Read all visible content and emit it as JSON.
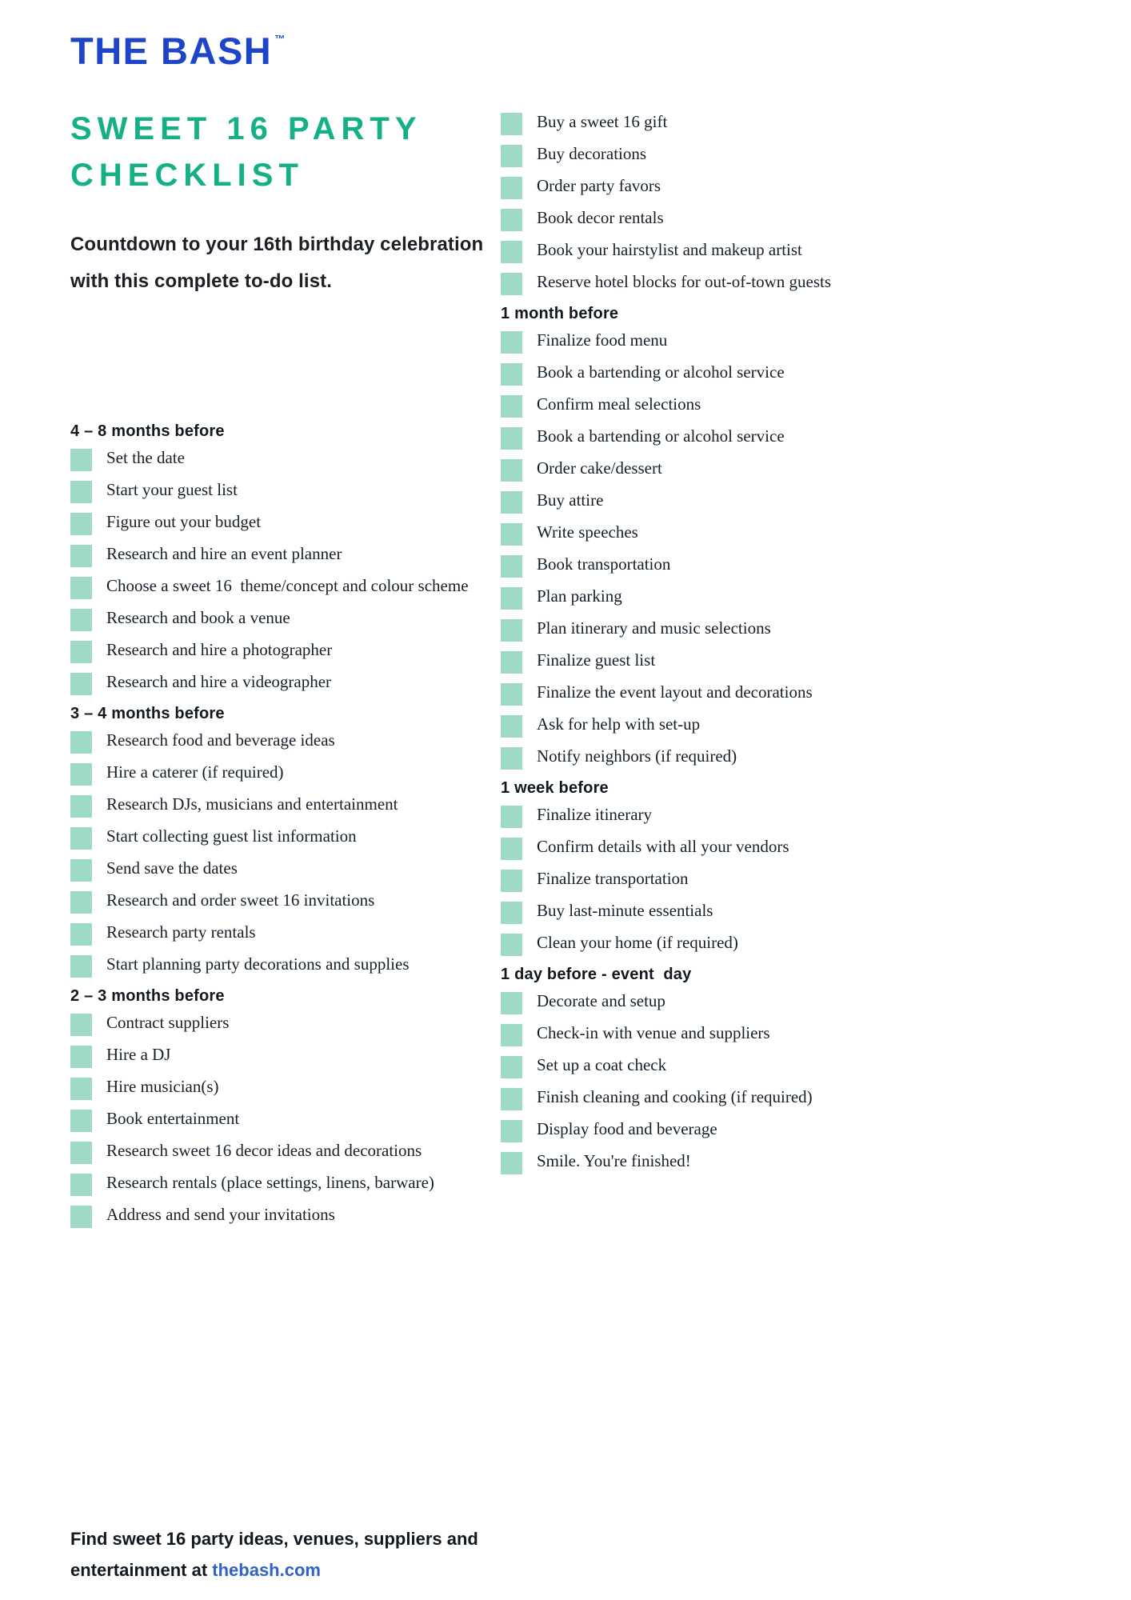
{
  "brand": {
    "logo_text": "THE BASH",
    "trademark": "™",
    "logo_color": "#1e45c8"
  },
  "header": {
    "title": "SWEET 16 PARTY CHECKLIST",
    "title_color": "#16b088",
    "subtitle": "Countdown to your 16th birthday celebration with this complete to-do list."
  },
  "theme": {
    "checkbox_color": "#9fd9c8",
    "accent_green": "#16b088",
    "link_color": "#2f62c4",
    "text_color": "#16202a",
    "background": "#ffffff"
  },
  "left_column": [
    {
      "heading": "4 – 8 months before",
      "items": [
        "Set the date",
        "Start your guest list",
        "Figure out your budget",
        "Research and hire an event planner",
        "Choose a sweet 16  theme/concept and colour scheme",
        "Research and book a venue",
        "Research and hire a photographer",
        "Research and hire a videographer"
      ]
    },
    {
      "heading": "3 – 4 months before",
      "items": [
        "Research food and beverage ideas",
        "Hire a caterer (if required)",
        "Research DJs, musicians and entertainment",
        "Start collecting guest list information",
        "Send save the dates",
        "Research and order sweet 16 invitations",
        "Research party rentals",
        "Start planning party decorations and supplies"
      ]
    },
    {
      "heading": "2 – 3 months before",
      "items": [
        "Contract suppliers",
        "Hire a DJ",
        "Hire musician(s)",
        "Book entertainment",
        "Research sweet 16 decor ideas and decorations",
        "Research rentals (place settings, linens, barware)",
        "Address and send your invitations"
      ]
    }
  ],
  "right_column": [
    {
      "heading": "",
      "items": [
        "Buy a sweet 16 gift",
        "Buy decorations",
        "Order party favors",
        "Book decor rentals",
        "Book your hairstylist and makeup artist",
        "Reserve hotel blocks for out-of-town guests"
      ]
    },
    {
      "heading": "1 month before",
      "items": [
        "Finalize food menu",
        "Book a bartending or alcohol service",
        "Confirm meal selections",
        "Book a bartending or alcohol service",
        "Order cake/dessert",
        "Buy attire",
        "Write speeches",
        "Book transportation",
        "Plan parking",
        "Plan itinerary and music selections",
        "Finalize guest list",
        "Finalize the event layout and decorations",
        "Ask for help with set-up",
        "Notify neighbors (if required)"
      ]
    },
    {
      "heading": "1 week before",
      "items": [
        "Finalize itinerary",
        "Confirm details with all your vendors",
        "Finalize transportation",
        "Buy last-minute essentials",
        "Clean your home (if required)"
      ]
    },
    {
      "heading": "1 day before - event  day",
      "items": [
        "Decorate and setup",
        "Check-in with venue and suppliers",
        "Set up a coat check",
        "Finish cleaning and cooking (if required)",
        "Display food and beverage",
        "Smile. You're finished!"
      ]
    }
  ],
  "footer": {
    "line1": "Find sweet 16 party ideas, venues, suppliers and",
    "line2_prefix": "entertainment at ",
    "link_text": "thebash.com"
  }
}
